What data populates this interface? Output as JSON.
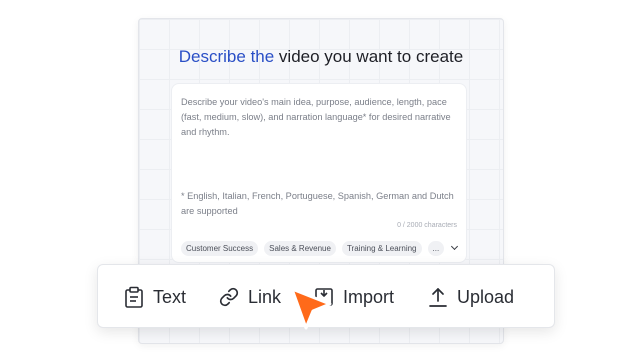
{
  "card": {
    "title_accent": "Describe the",
    "title_rest": " video you want to create",
    "placeholder": "Describe your video's main idea, purpose, audience, length, pace (fast, medium, slow), and narration language* for desired narrative and rhythm.",
    "note": "* English, Italian, French, Portuguese, Spanish, German and Dutch are supported",
    "counter": "0 / 2000 characters",
    "chips": [
      "Customer Success",
      "Sales & Revenue",
      "Training & Learning",
      "..."
    ]
  },
  "toolbar": {
    "text_label": "Text",
    "link_label": "Link",
    "import_label": "Import",
    "upload_label": "Upload"
  },
  "colors": {
    "accent": "#2a4fc6",
    "cursor": "#ff6a1a"
  },
  "icons": [
    "clipboard-icon",
    "link-icon",
    "import-icon",
    "upload-icon",
    "chevron-down-icon",
    "pointer-cursor-icon"
  ]
}
